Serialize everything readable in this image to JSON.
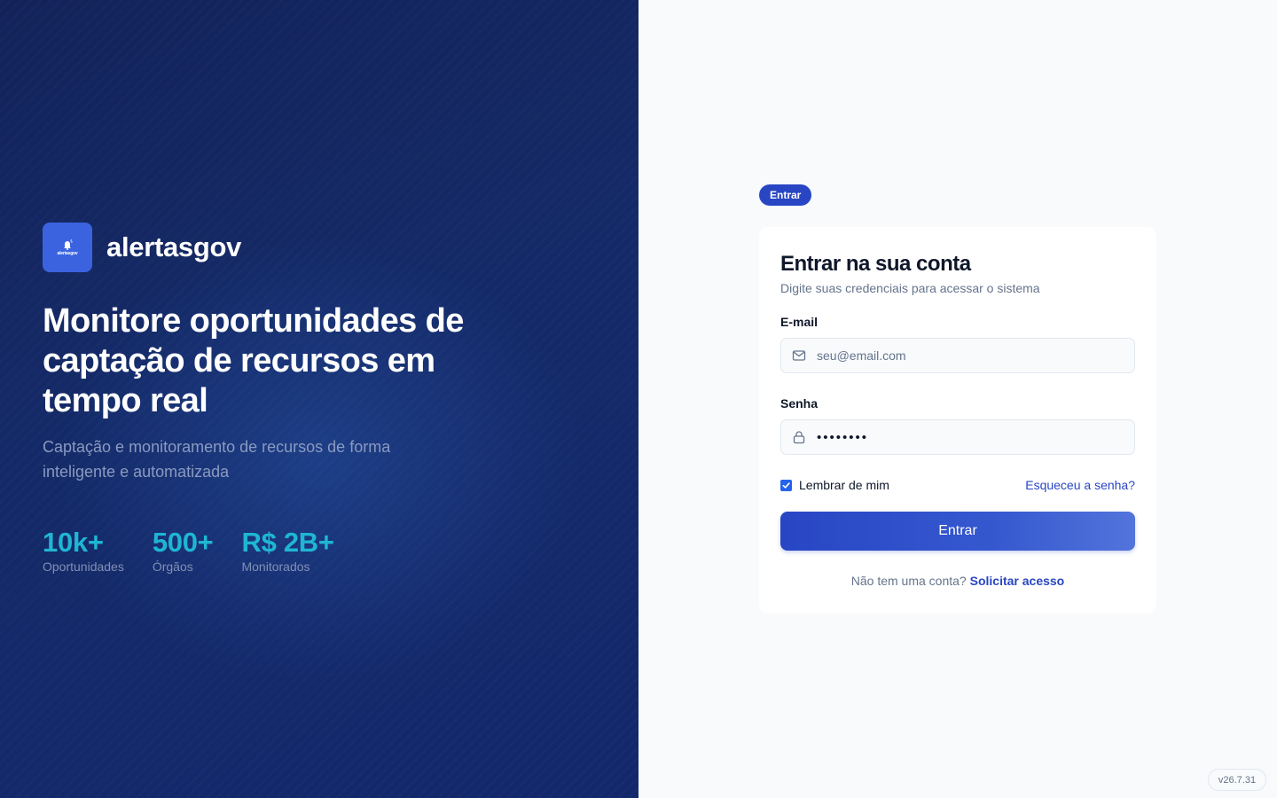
{
  "brand": {
    "name": "alertasgov",
    "logo_text": "alertasgov"
  },
  "hero": {
    "title": "Monitore oportunidades de captação de recursos em tempo real",
    "subtitle": "Captação e monitoramento de recursos de forma inteligente e automatizada",
    "stats": [
      {
        "value": "10k+",
        "label": "Oportunidades"
      },
      {
        "value": "500+",
        "label": "Órgãos"
      },
      {
        "value": "R$ 2B+",
        "label": "Monitorados"
      }
    ]
  },
  "login": {
    "badge": "Entrar",
    "title": "Entrar na sua conta",
    "subtitle": "Digite suas credenciais para acessar o sistema",
    "email_label": "E-mail",
    "email_placeholder": "seu@email.com",
    "email_value": "",
    "password_label": "Senha",
    "password_value": "••••••••",
    "remember_label": "Lembrar de mim",
    "remember_checked": true,
    "forgot_label": "Esqueceu a senha?",
    "submit_label": "Entrar",
    "signup_prompt": "Não tem uma conta?",
    "signup_link": "Solicitar acesso"
  },
  "version": "v26.7.31",
  "colors": {
    "hero_bg": "#142a68",
    "accent": "#2846c4",
    "stat": "#1fb6d4",
    "logo_bg": "#3b63e0"
  },
  "icons": {
    "email": "mail-icon",
    "password": "lock-icon",
    "logo": "bell-icon",
    "checkbox": "check-icon"
  }
}
